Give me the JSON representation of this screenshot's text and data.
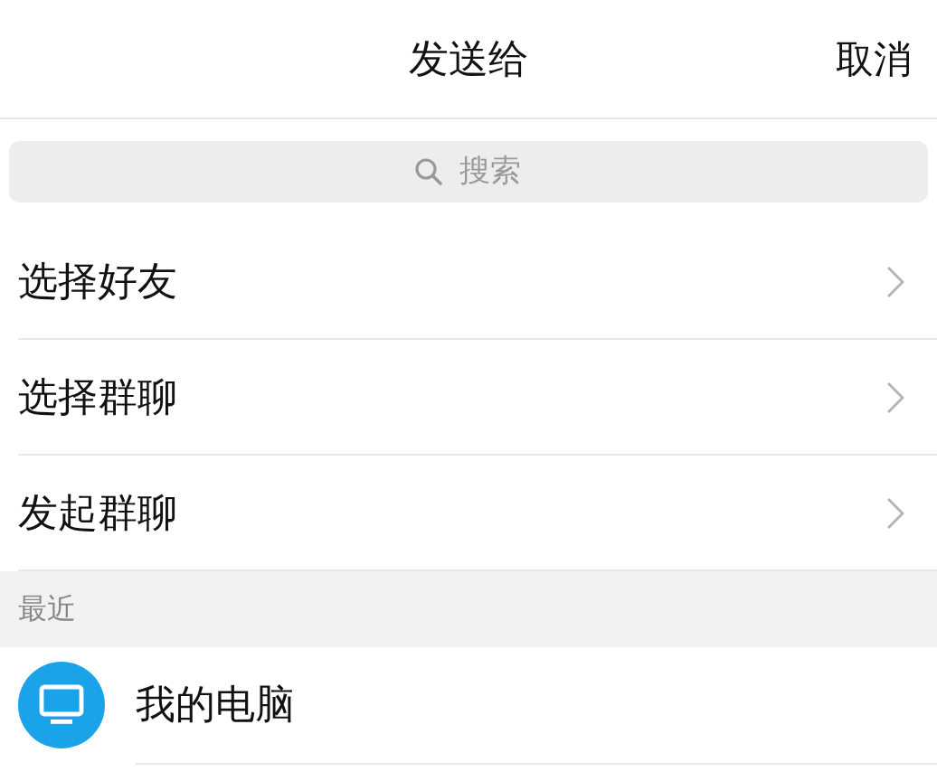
{
  "header": {
    "title": "发送给",
    "cancel": "取消"
  },
  "search": {
    "placeholder": "搜索"
  },
  "actions": [
    {
      "label": "选择好友"
    },
    {
      "label": "选择群聊"
    },
    {
      "label": "发起群聊"
    }
  ],
  "recent": {
    "heading": "最近",
    "contacts": [
      {
        "name": "我的电脑",
        "kind": "computer"
      }
    ]
  }
}
